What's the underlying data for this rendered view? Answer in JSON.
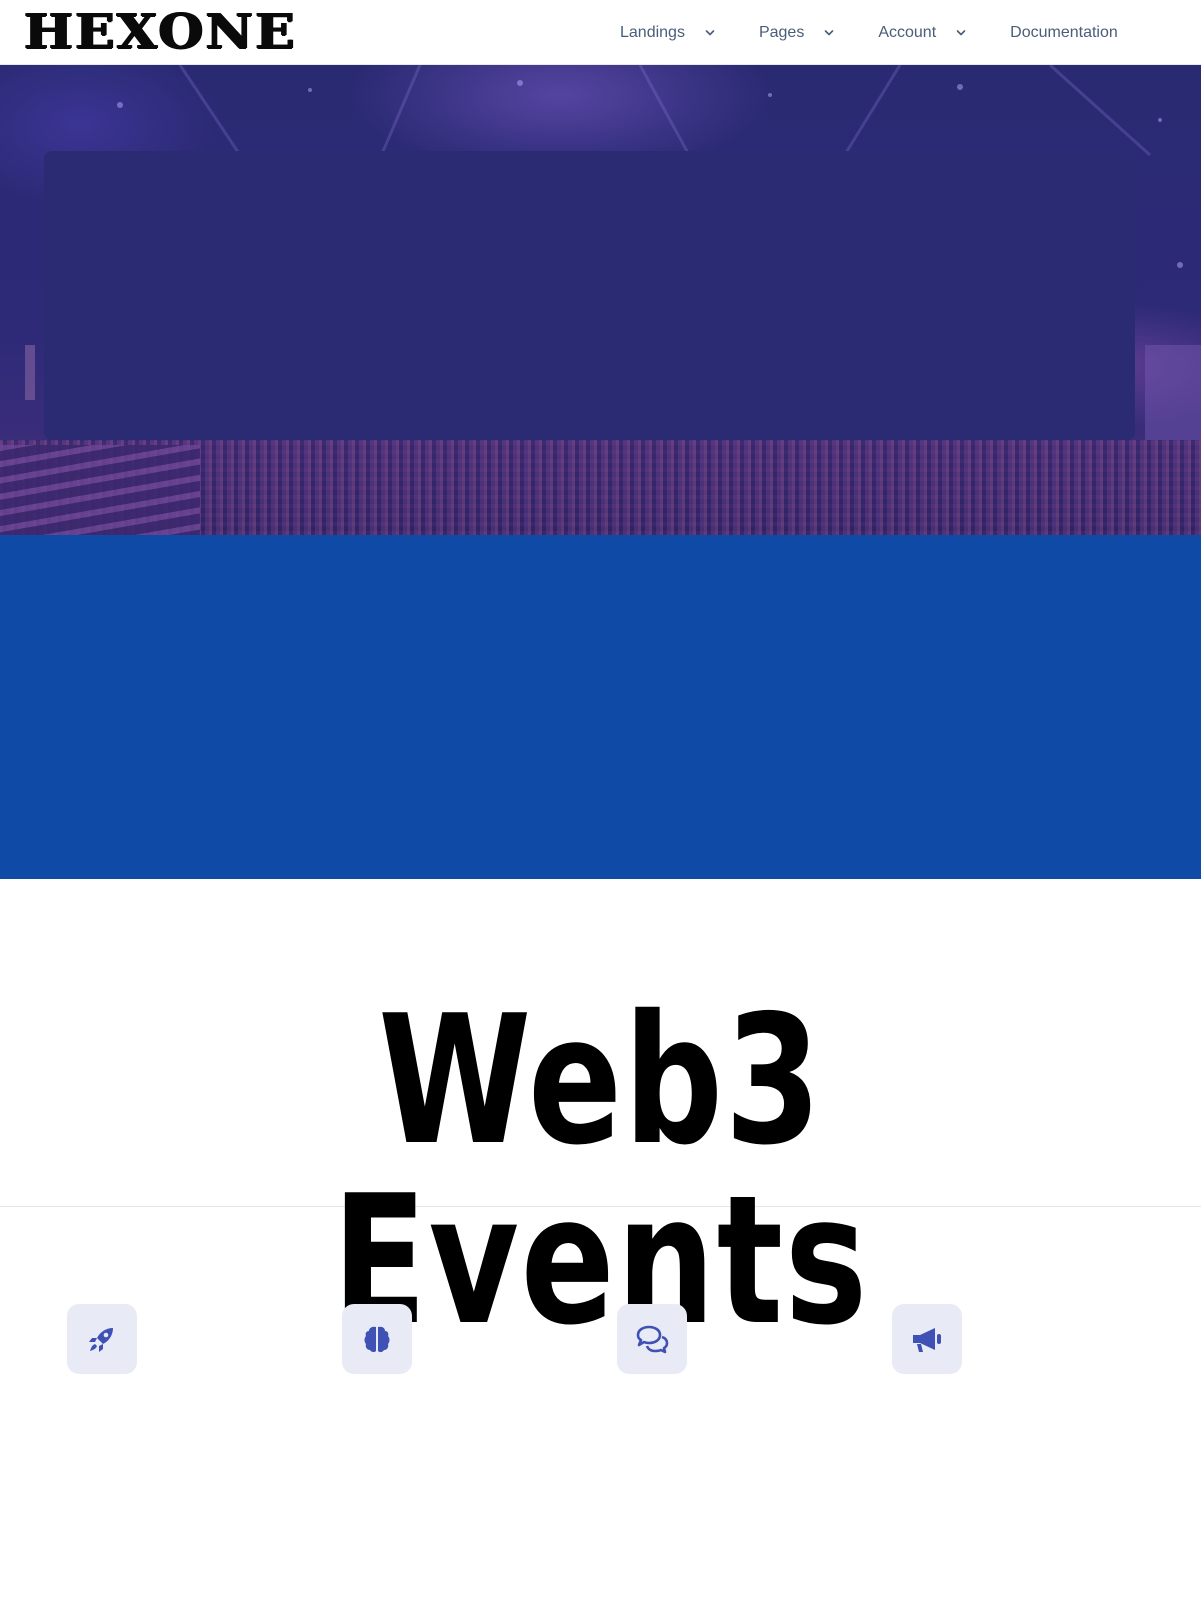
{
  "header": {
    "logo_text": "HEXONE",
    "nav": [
      {
        "label": "Landings",
        "has_dropdown": true
      },
      {
        "label": "Pages",
        "has_dropdown": true
      },
      {
        "label": "Account",
        "has_dropdown": true
      },
      {
        "label": "Documentation",
        "has_dropdown": false
      }
    ]
  },
  "main": {
    "title": "Web3 Events"
  },
  "features": [
    {
      "icon": "rocket-icon"
    },
    {
      "icon": "brain-icon"
    },
    {
      "icon": "comments-icon"
    },
    {
      "icon": "megaphone-icon"
    }
  ],
  "colors": {
    "nav_text": "#4a5d7a",
    "hero_overlay": "#2b2b74",
    "blue_band": "#0f4aa6",
    "icon_tile_bg": "#e8eaf6",
    "icon_color": "#3f51b5"
  }
}
